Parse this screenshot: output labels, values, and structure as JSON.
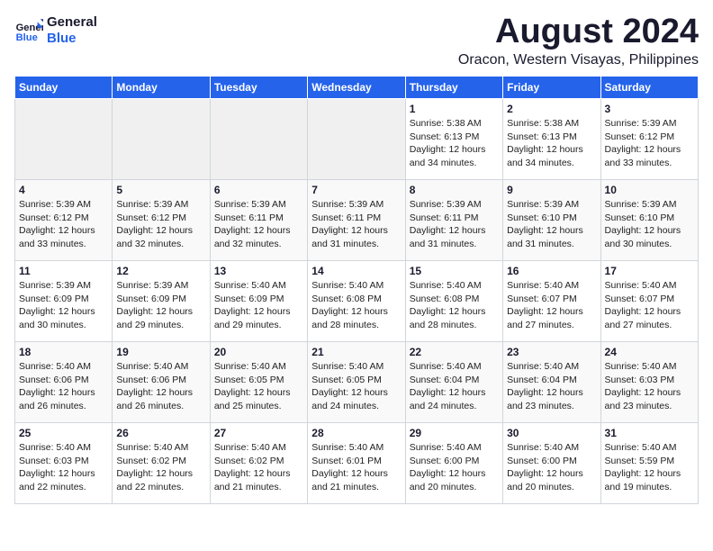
{
  "logo": {
    "line1": "General",
    "line2": "Blue"
  },
  "title": "August 2024",
  "subtitle": "Oracon, Western Visayas, Philippines",
  "days_of_week": [
    "Sunday",
    "Monday",
    "Tuesday",
    "Wednesday",
    "Thursday",
    "Friday",
    "Saturday"
  ],
  "weeks": [
    [
      {
        "day": "",
        "info": ""
      },
      {
        "day": "",
        "info": ""
      },
      {
        "day": "",
        "info": ""
      },
      {
        "day": "",
        "info": ""
      },
      {
        "day": "1",
        "info": "Sunrise: 5:38 AM\nSunset: 6:13 PM\nDaylight: 12 hours\nand 34 minutes."
      },
      {
        "day": "2",
        "info": "Sunrise: 5:38 AM\nSunset: 6:13 PM\nDaylight: 12 hours\nand 34 minutes."
      },
      {
        "day": "3",
        "info": "Sunrise: 5:39 AM\nSunset: 6:12 PM\nDaylight: 12 hours\nand 33 minutes."
      }
    ],
    [
      {
        "day": "4",
        "info": "Sunrise: 5:39 AM\nSunset: 6:12 PM\nDaylight: 12 hours\nand 33 minutes."
      },
      {
        "day": "5",
        "info": "Sunrise: 5:39 AM\nSunset: 6:12 PM\nDaylight: 12 hours\nand 32 minutes."
      },
      {
        "day": "6",
        "info": "Sunrise: 5:39 AM\nSunset: 6:11 PM\nDaylight: 12 hours\nand 32 minutes."
      },
      {
        "day": "7",
        "info": "Sunrise: 5:39 AM\nSunset: 6:11 PM\nDaylight: 12 hours\nand 31 minutes."
      },
      {
        "day": "8",
        "info": "Sunrise: 5:39 AM\nSunset: 6:11 PM\nDaylight: 12 hours\nand 31 minutes."
      },
      {
        "day": "9",
        "info": "Sunrise: 5:39 AM\nSunset: 6:10 PM\nDaylight: 12 hours\nand 31 minutes."
      },
      {
        "day": "10",
        "info": "Sunrise: 5:39 AM\nSunset: 6:10 PM\nDaylight: 12 hours\nand 30 minutes."
      }
    ],
    [
      {
        "day": "11",
        "info": "Sunrise: 5:39 AM\nSunset: 6:09 PM\nDaylight: 12 hours\nand 30 minutes."
      },
      {
        "day": "12",
        "info": "Sunrise: 5:39 AM\nSunset: 6:09 PM\nDaylight: 12 hours\nand 29 minutes."
      },
      {
        "day": "13",
        "info": "Sunrise: 5:40 AM\nSunset: 6:09 PM\nDaylight: 12 hours\nand 29 minutes."
      },
      {
        "day": "14",
        "info": "Sunrise: 5:40 AM\nSunset: 6:08 PM\nDaylight: 12 hours\nand 28 minutes."
      },
      {
        "day": "15",
        "info": "Sunrise: 5:40 AM\nSunset: 6:08 PM\nDaylight: 12 hours\nand 28 minutes."
      },
      {
        "day": "16",
        "info": "Sunrise: 5:40 AM\nSunset: 6:07 PM\nDaylight: 12 hours\nand 27 minutes."
      },
      {
        "day": "17",
        "info": "Sunrise: 5:40 AM\nSunset: 6:07 PM\nDaylight: 12 hours\nand 27 minutes."
      }
    ],
    [
      {
        "day": "18",
        "info": "Sunrise: 5:40 AM\nSunset: 6:06 PM\nDaylight: 12 hours\nand 26 minutes."
      },
      {
        "day": "19",
        "info": "Sunrise: 5:40 AM\nSunset: 6:06 PM\nDaylight: 12 hours\nand 26 minutes."
      },
      {
        "day": "20",
        "info": "Sunrise: 5:40 AM\nSunset: 6:05 PM\nDaylight: 12 hours\nand 25 minutes."
      },
      {
        "day": "21",
        "info": "Sunrise: 5:40 AM\nSunset: 6:05 PM\nDaylight: 12 hours\nand 24 minutes."
      },
      {
        "day": "22",
        "info": "Sunrise: 5:40 AM\nSunset: 6:04 PM\nDaylight: 12 hours\nand 24 minutes."
      },
      {
        "day": "23",
        "info": "Sunrise: 5:40 AM\nSunset: 6:04 PM\nDaylight: 12 hours\nand 23 minutes."
      },
      {
        "day": "24",
        "info": "Sunrise: 5:40 AM\nSunset: 6:03 PM\nDaylight: 12 hours\nand 23 minutes."
      }
    ],
    [
      {
        "day": "25",
        "info": "Sunrise: 5:40 AM\nSunset: 6:03 PM\nDaylight: 12 hours\nand 22 minutes."
      },
      {
        "day": "26",
        "info": "Sunrise: 5:40 AM\nSunset: 6:02 PM\nDaylight: 12 hours\nand 22 minutes."
      },
      {
        "day": "27",
        "info": "Sunrise: 5:40 AM\nSunset: 6:02 PM\nDaylight: 12 hours\nand 21 minutes."
      },
      {
        "day": "28",
        "info": "Sunrise: 5:40 AM\nSunset: 6:01 PM\nDaylight: 12 hours\nand 21 minutes."
      },
      {
        "day": "29",
        "info": "Sunrise: 5:40 AM\nSunset: 6:00 PM\nDaylight: 12 hours\nand 20 minutes."
      },
      {
        "day": "30",
        "info": "Sunrise: 5:40 AM\nSunset: 6:00 PM\nDaylight: 12 hours\nand 20 minutes."
      },
      {
        "day": "31",
        "info": "Sunrise: 5:40 AM\nSunset: 5:59 PM\nDaylight: 12 hours\nand 19 minutes."
      }
    ]
  ]
}
